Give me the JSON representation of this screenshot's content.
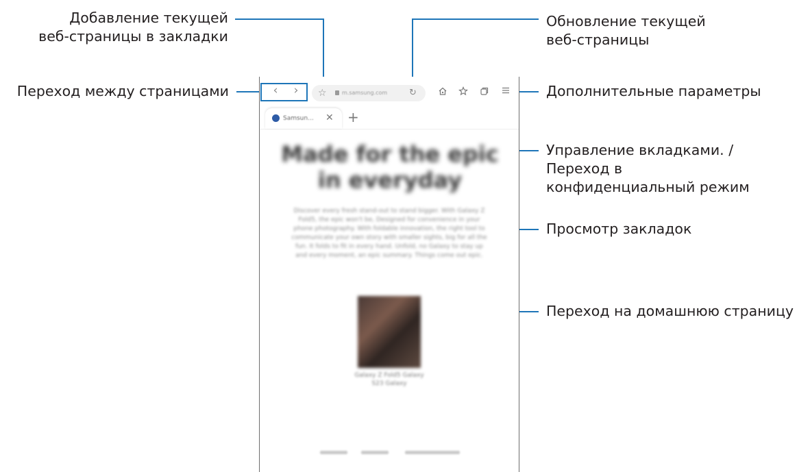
{
  "callouts": {
    "bookmark_add": {
      "line1": "Добавление текущей",
      "line2": "веб-страницы в закладки"
    },
    "reload": {
      "line1": "Обновление текущей",
      "line2": "веб-страницы"
    },
    "navigation": "Переход между страницами",
    "more_options": "Дополнительные параметры",
    "tabs_manager": {
      "line1": "Управление вкладками. /",
      "line2": "Переход в",
      "line3": "конфиденциальный режим"
    },
    "bookmarks_view": "Просмотр закладок",
    "home": "Переход на домашнюю страницу"
  },
  "browser": {
    "url": "m.samsung.com",
    "tab_title": "Samsun...",
    "headline": "Made for the epic in everyday",
    "paragraph": "Discover every fresh stand-out to stand bigger. With Galaxy Z Fold5, the epic won't be, Designed for convenience in your phone photography. With foldable innovation, the right tool to communicate your own story with smaller sights, big for all the fun. It folds to fit in every hand. Unfold, no Galaxy to stay up and every moment, an epic summary. Things come out epic.",
    "caption": "Galaxy Z Fold5 Galaxy S23 Galaxy",
    "footer_links": [
      "Samsung",
      "Galaxy",
      "Shop Now Today"
    ]
  },
  "colors": {
    "callout_line": "#1d75b8",
    "text": "#231f20"
  },
  "icons": {
    "back": "chevron-left-icon",
    "forward": "chevron-right-icon",
    "bookmark_add": "star-icon",
    "reload": "reload-icon",
    "home": "home-icon",
    "bookmarks": "bookmark-star-icon",
    "tabs": "tabs-icon",
    "menu": "menu-icon"
  }
}
